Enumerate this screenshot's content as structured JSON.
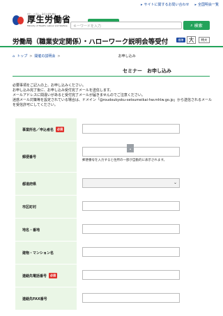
{
  "header": {
    "top_links": [
      {
        "label": "サイトに関するお問い合わせ"
      },
      {
        "label": "全国明会一覧"
      }
    ],
    "logo_small": "ひと、くらし、みらいのために",
    "logo_main": "厚生労働省",
    "logo_en": "Ministry of Health, Labour and Welfare",
    "search_placeholder": "キーワードを入力",
    "search_button": "検索"
  },
  "title_bar": {
    "title": "労働局（職業安定関係）・ハローワーク説明会等受付",
    "std_label": "標準",
    "big_label": "大",
    "xl_label": "特大"
  },
  "breadcrumb": {
    "home": "トップ",
    "middle": "開催の説明会",
    "current": "お申し込み"
  },
  "section_title": "セミナー　お申し込み",
  "notice_lines": [
    "必要事項をご記入の上、お申し込みください。",
    "お申し込み完了後に、お申し込み受付完了メールを送信します。",
    "メールアドレスに間違いがあると受付完了メールが届きませんのでご注意ください。",
    "迷惑メール対策等を設定されている場合は、ドメイン「@roudoukyoku-setsumeikai-hw.mhlw.go.jp」から送信されるメールを受信許可にしてください。"
  ],
  "form": {
    "required_label": "必須",
    "rows": [
      {
        "label": "事業所名／申込者名",
        "required": true,
        "type": "input"
      },
      {
        "label": "郵便番号",
        "required": false,
        "type": "postal",
        "help": "郵便番号を入力すると住所の一部が自動的に表示されます。"
      },
      {
        "label": "都道府県",
        "required": false,
        "type": "select"
      },
      {
        "label": "市区町村",
        "required": false,
        "type": "input"
      },
      {
        "label": "地名・番地",
        "required": false,
        "type": "input"
      },
      {
        "label": "建物・マンション名",
        "required": false,
        "type": "input"
      },
      {
        "label": "連絡先電話番号",
        "required": true,
        "type": "input"
      },
      {
        "label": "連絡先FAX番号",
        "required": false,
        "type": "input"
      }
    ]
  },
  "colors": {
    "accent_green": "#23a35a",
    "label_bg": "#eaf6e6",
    "required_red": "#e0342e",
    "brand_blue": "#1d4aa3"
  }
}
